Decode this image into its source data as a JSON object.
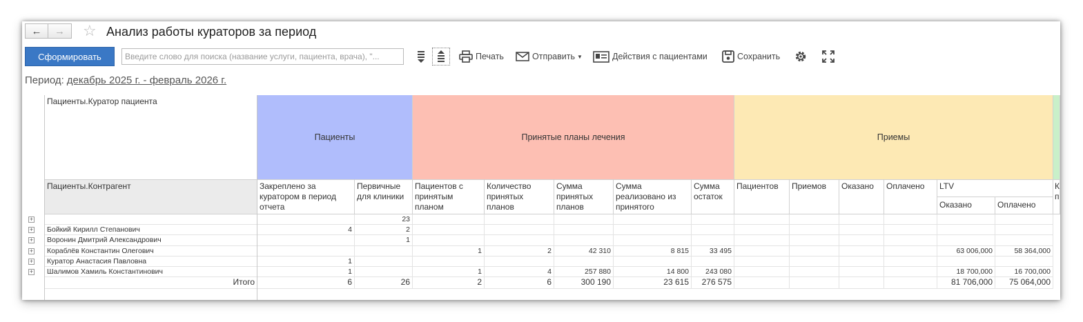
{
  "window": {
    "title": "Анализ работы кураторов за период",
    "back_icon": "arrow-left-icon",
    "forward_icon": "arrow-right-icon",
    "favorite_icon": "star-icon"
  },
  "toolbar": {
    "generate_label": "Сформировать",
    "search_placeholder": "Введите слово для поиска (название услуги, пациента, врача), \"...",
    "print_label": "Печать",
    "send_label": "Отправить",
    "actions_label": "Действия с пациентами",
    "save_label": "Сохранить"
  },
  "period": {
    "label": "Период:",
    "value": "декабрь 2025 г. - февраль 2026 г."
  },
  "colors": {
    "patients_group": "#b0bdfc",
    "plans_group": "#fdbfb3",
    "visits_group": "#fde9b4",
    "next_group": "#c9f0c9",
    "primary_button": "#3a78c5"
  },
  "report": {
    "row_header_1": "Пациенты.Куратор пациента",
    "row_header_2": "Пациенты.Контрагент",
    "groups": [
      {
        "label": "Пациенты"
      },
      {
        "label": "Принятые планы лечения"
      },
      {
        "label": "Приемы"
      }
    ],
    "columns": [
      "Закреплено за куратором в период отчета",
      "Первичные для клиники",
      "Пациентов с принятым планом",
      "Количество принятых планов",
      "Сумма принятых планов",
      "Сумма реализовано из принятого",
      "Сумма остаток",
      "Пациентов",
      "Приемов",
      "Оказано",
      "Оплачено",
      "LTV"
    ],
    "ltv_subcolumns": [
      "Оказано",
      "Оплачено"
    ],
    "cut_column_label": "К п",
    "rows": [
      {
        "name": "",
        "values": [
          "",
          "23",
          "",
          "",
          "",
          "",
          "",
          "",
          "",
          "",
          "",
          "",
          ""
        ]
      },
      {
        "name": "Бойкий Кирилл Степанович",
        "values": [
          "4",
          "2",
          "",
          "",
          "",
          "",
          "",
          "",
          "",
          "",
          "",
          "",
          ""
        ]
      },
      {
        "name": "Воронин Дмитрий Александрович",
        "values": [
          "",
          "1",
          "",
          "",
          "",
          "",
          "",
          "",
          "",
          "",
          "",
          "",
          ""
        ]
      },
      {
        "name": "Кораблёв Константин Олегович",
        "values": [
          "",
          "",
          "1",
          "2",
          "42 310",
          "8 815",
          "33 495",
          "",
          "",
          "",
          "",
          "63 006,000",
          "58 364,000"
        ]
      },
      {
        "name": "Куратор Анастасия Павловна",
        "values": [
          "1",
          "",
          "",
          "",
          "",
          "",
          "",
          "",
          "",
          "",
          "",
          "",
          ""
        ]
      },
      {
        "name": "Шалимов Хамиль Константинович",
        "values": [
          "1",
          "",
          "1",
          "4",
          "257 880",
          "14 800",
          "243 080",
          "",
          "",
          "",
          "",
          "18 700,000",
          "16 700,000"
        ]
      }
    ],
    "total": {
      "name": "Итого",
      "values": [
        "6",
        "26",
        "2",
        "6",
        "300 190",
        "23 615",
        "276 575",
        "",
        "",
        "",
        "",
        "81 706,000",
        "75 064,000"
      ]
    }
  }
}
